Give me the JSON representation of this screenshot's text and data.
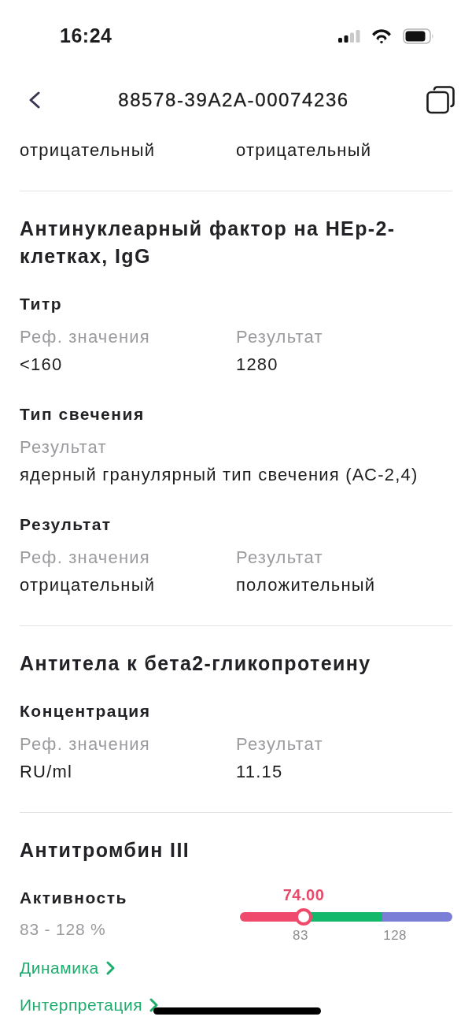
{
  "status_bar": {
    "time": "16:24"
  },
  "header": {
    "title": "88578-39A2A-00074236"
  },
  "sections": [
    {
      "params": [
        {
          "kind": "fields",
          "fields": [
            {
              "value": "отрицательный"
            },
            {
              "value": "отрицательный"
            }
          ]
        }
      ]
    },
    {
      "title": "Антинуклеарный фактор на HEp-2-клетках, IgG",
      "params": [
        {
          "kind": "fields",
          "name": "Титр",
          "fields": [
            {
              "label": "Реф. значения",
              "value": "<160"
            },
            {
              "label": "Результат",
              "value": "1280"
            }
          ]
        },
        {
          "kind": "fields",
          "name": "Тип свечения",
          "fields": [
            {
              "label": "Результат",
              "value": "ядерный гранулярный тип свечения (АС-2,4)"
            }
          ]
        },
        {
          "kind": "fields",
          "name": "Результат",
          "fields": [
            {
              "label": "Реф. значения",
              "value": "отрицательный"
            },
            {
              "label": "Результат",
              "value": "положительный"
            }
          ]
        }
      ]
    },
    {
      "title": "Антитела к бета2-гликопротеину",
      "params": [
        {
          "kind": "fields",
          "name": "Концентрация",
          "fields": [
            {
              "label": "Реф. значения",
              "value": "RU/ml"
            },
            {
              "label": "Результат",
              "value": "11.15"
            }
          ]
        }
      ]
    },
    {
      "title": "Антитромбин III",
      "params": [
        {
          "kind": "range",
          "name": "Активность",
          "range": "83 - 128 %",
          "reading": "74.00",
          "out_of_range": true,
          "level": 0.3,
          "ticks": [
            "83",
            "128"
          ]
        }
      ],
      "links": [
        {
          "label": "Динамика"
        },
        {
          "label": "Интерпретация"
        }
      ]
    }
  ]
}
